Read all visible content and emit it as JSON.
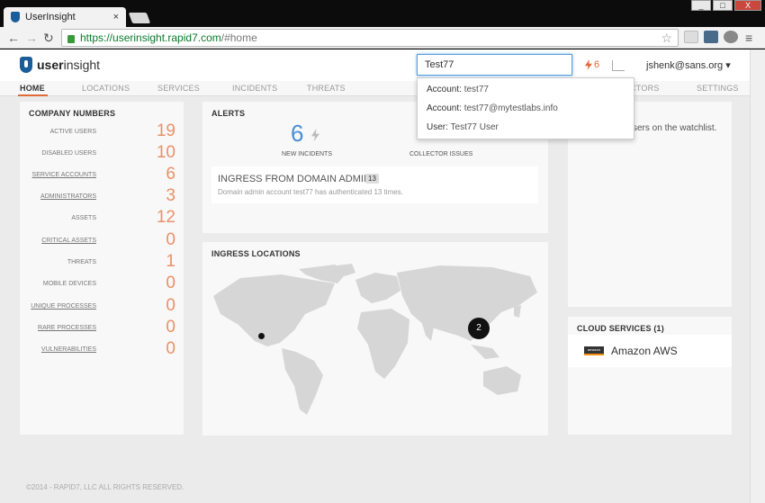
{
  "browser": {
    "tab_title": "UserInsight",
    "tab_close": "×",
    "window_buttons": {
      "minimize": "_",
      "maximize": "□",
      "close": "X"
    },
    "url_host": "https://userinsight.rapid7.com",
    "url_path": "/#home"
  },
  "header": {
    "logo_bold": "user",
    "logo_rest": "insight",
    "search_value": "Test77",
    "alert_count": "6",
    "user_menu": "jshenk@sans.org ▾"
  },
  "nav": {
    "tabs": [
      "HOME",
      "LOCATIONS",
      "SERVICES",
      "INCIDENTS",
      "THREATS",
      "COLLECTORS",
      "SETTINGS"
    ],
    "collectors_visible": "ECTORS",
    "active": "HOME"
  },
  "search_results": [
    {
      "key": "Account:",
      "value": " test77"
    },
    {
      "key": "Account:",
      "value": " test77@mytestlabs.info"
    },
    {
      "key": "User:",
      "value": " Test77 User"
    }
  ],
  "company_numbers": {
    "title": "COMPANY NUMBERS",
    "rows": [
      {
        "label": "ACTIVE USERS",
        "value": "19"
      },
      {
        "label": "DISABLED USERS",
        "value": "10"
      },
      {
        "label": "SERVICE ACCOUNTS",
        "value": "6"
      },
      {
        "label": "ADMINISTRATORS",
        "value": "3"
      },
      {
        "label": "ASSETS",
        "value": "12"
      },
      {
        "label": "CRITICAL ASSETS",
        "value": "0"
      },
      {
        "label": "THREATS",
        "value": "1"
      },
      {
        "label": "MOBILE DEVICES",
        "value": "0"
      },
      {
        "label": "UNIQUE PROCESSES",
        "value": "0"
      },
      {
        "label": "RARE PROCESSES",
        "value": "0"
      },
      {
        "label": "VULNERABILITIES",
        "value": "0"
      }
    ]
  },
  "alerts": {
    "title": "ALERTS",
    "new_incidents_count": "6",
    "new_incidents_label": "NEW INCIDENTS",
    "collector_issues_label": "COLLECTOR ISSUES",
    "incident": {
      "title": "INGRESS FROM DOMAIN ADMIN",
      "badge": "13",
      "description": "Domain admin account test77 has authenticated 13 times."
    }
  },
  "ingress": {
    "title": "INGRESS LOCATIONS",
    "cluster_count": "2"
  },
  "watchlist": {
    "visible_text": "sers on the watchlist."
  },
  "cloud": {
    "title": "CLOUD SERVICES (1)",
    "service": "Amazon AWS",
    "logo_text": "amazon"
  },
  "footer": "©2014 - RAPID7, LLC ALL RIGHTS RESERVED.",
  "colors": {
    "accent_orange": "#e06a3a",
    "number_orange": "#e8916a",
    "brand_blue": "#1a5d9a",
    "incident_blue": "#4a8fd1"
  }
}
